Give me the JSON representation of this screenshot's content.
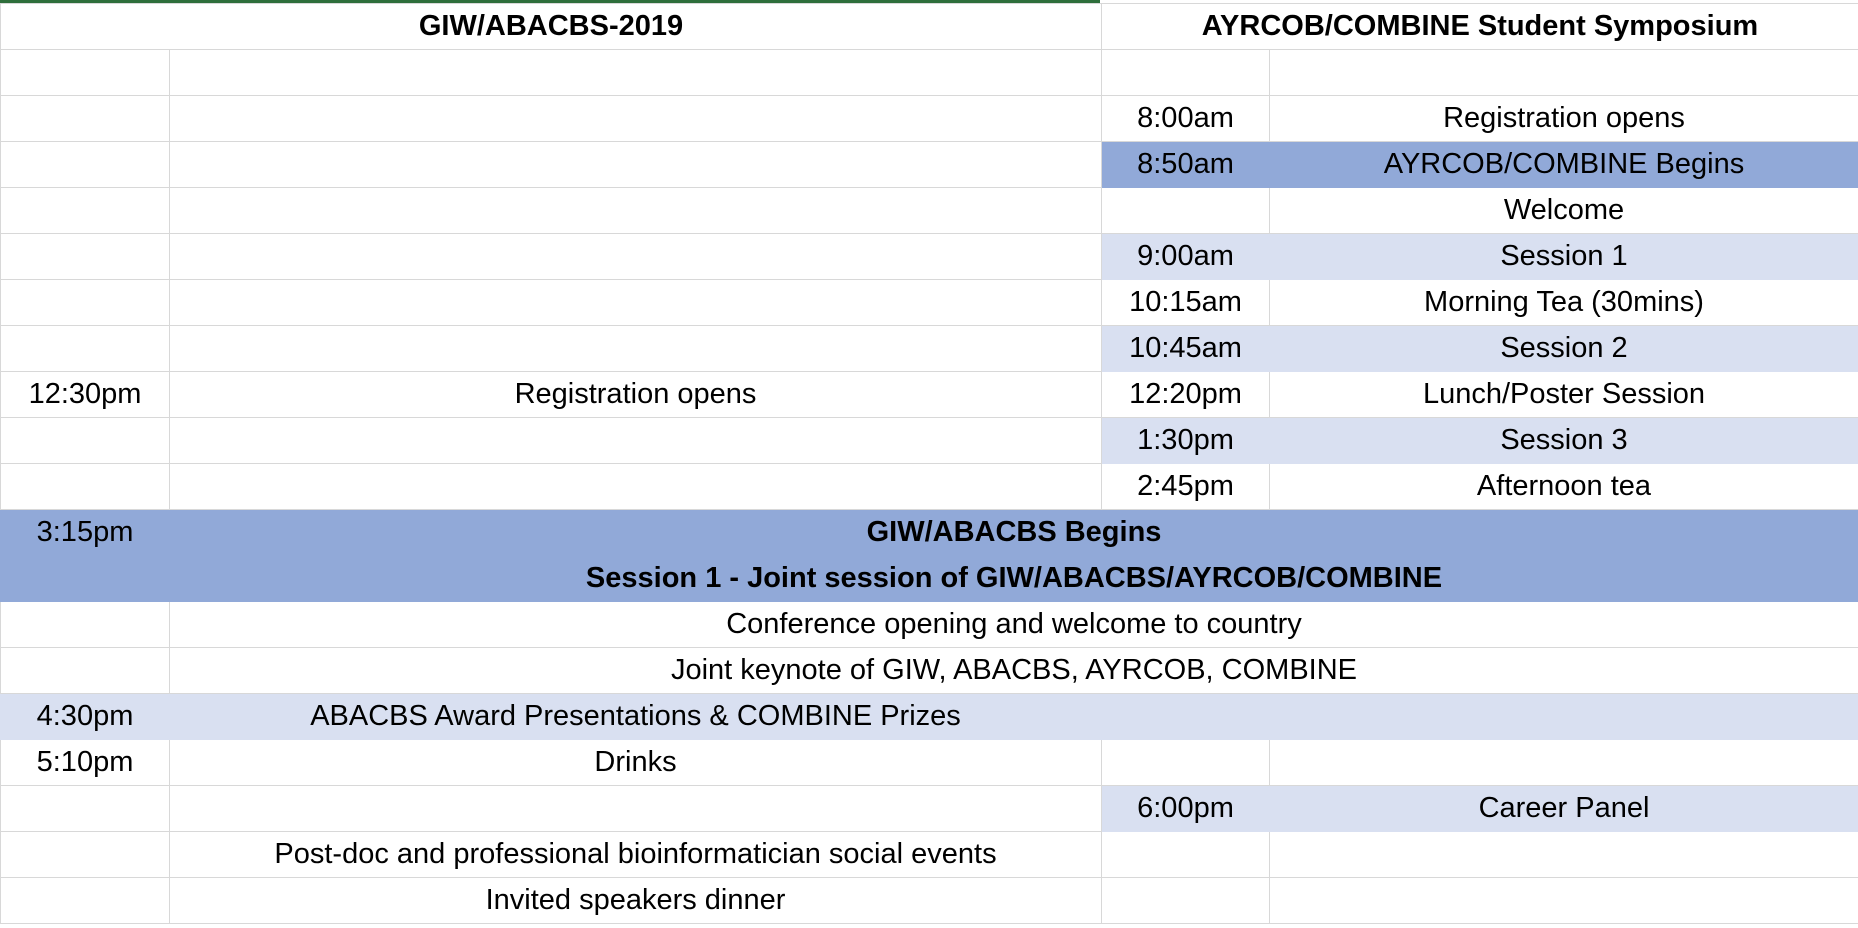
{
  "headers": {
    "left": "GIW/ABACBS-2019",
    "right": "AYRCOB/COMBINE Student Symposium"
  },
  "right_schedule": [
    {
      "time": "8:00am",
      "event": "Registration opens"
    },
    {
      "time": "8:50am",
      "event": "AYRCOB/COMBINE Begins"
    },
    {
      "time": "",
      "event": "Welcome"
    },
    {
      "time": "9:00am",
      "event": "Session 1"
    },
    {
      "time": "10:15am",
      "event": "Morning Tea (30mins)"
    },
    {
      "time": "10:45am",
      "event": "Session 2"
    },
    {
      "time": "12:20pm",
      "event": "Lunch/Poster Session"
    },
    {
      "time": "1:30pm",
      "event": "Session 3"
    },
    {
      "time": "2:45pm",
      "event": "Afternoon tea"
    }
  ],
  "left_schedule": {
    "registration": {
      "time": "12:30pm",
      "event": "Registration opens"
    },
    "award": {
      "time": "4:30pm",
      "event": "ABACBS Award Presentations & COMBINE Prizes"
    },
    "drinks": {
      "time": "5:10pm",
      "event": "Drinks"
    },
    "postdoc": {
      "event": "Post-doc and professional bioinformatician social events"
    },
    "dinner": {
      "event": "Invited speakers dinner"
    }
  },
  "joint": {
    "time": "3:15pm",
    "title": "GIW/ABACBS Begins",
    "session": "Session 1 -  Joint session of GIW/ABACBS/AYRCOB/COMBINE",
    "opening": "Conference opening and welcome to country",
    "keynote": "Joint keynote of GIW, ABACBS, AYRCOB, COMBINE"
  },
  "career": {
    "time": "6:00pm",
    "event": "Career Panel"
  },
  "colors": {
    "dark_band": "#91a9d8",
    "light_band": "#d9e0f1",
    "grid": "#d8d8d8",
    "top_accent": "#2e6e3b"
  }
}
